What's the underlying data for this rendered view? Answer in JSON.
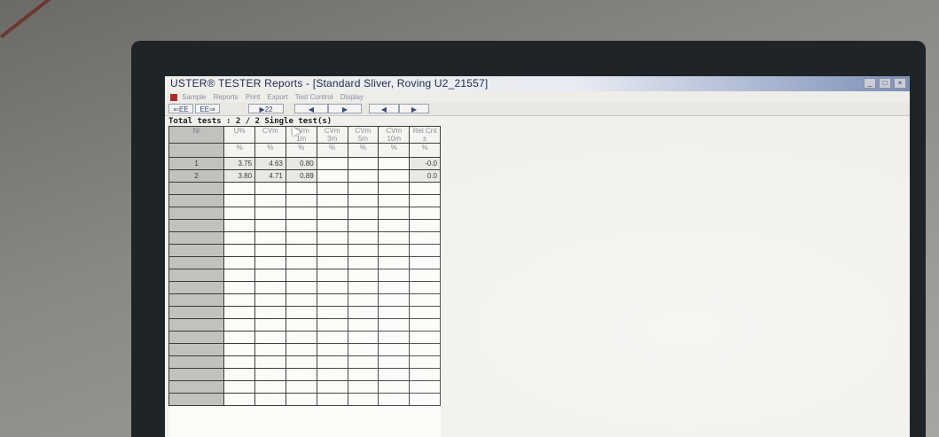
{
  "window": {
    "title": "USTER® TESTER   Reports - [Standard Sliver, Roving U2_21557]",
    "controls": [
      "_",
      "□",
      "×"
    ]
  },
  "menu": {
    "items": [
      "Sample",
      "Reports",
      "Print",
      "Export",
      "Test Control",
      "Display"
    ]
  },
  "toolbar": {
    "prev_label": "⇐EE",
    "next_label": "EE⇒",
    "page_label": "▶22",
    "nav": [
      "◀",
      "▶",
      "◀",
      "▶"
    ]
  },
  "status": {
    "total_tests": "Total tests : 2 / 2 Single test(s)"
  },
  "table": {
    "headers": [
      {
        "label": "Nr",
        "unit": ""
      },
      {
        "label": "U%",
        "unit": "%"
      },
      {
        "label": "CVm",
        "unit": "%"
      },
      {
        "label": "CVm 1m",
        "unit": "%"
      },
      {
        "label": "CVm 3m",
        "unit": "%"
      },
      {
        "label": "CVm 5m",
        "unit": "%"
      },
      {
        "label": "CVm 10m",
        "unit": "%"
      },
      {
        "label": "Rel Cnt ±",
        "unit": "%"
      }
    ],
    "rows": [
      [
        "1",
        "3.75",
        "4.63",
        "0.80",
        "",
        "",
        "",
        "-0.0"
      ],
      [
        "2",
        "3.80",
        "4.71",
        "0.89",
        "",
        "",
        "",
        "0.0"
      ]
    ],
    "empty_rows": 18
  }
}
